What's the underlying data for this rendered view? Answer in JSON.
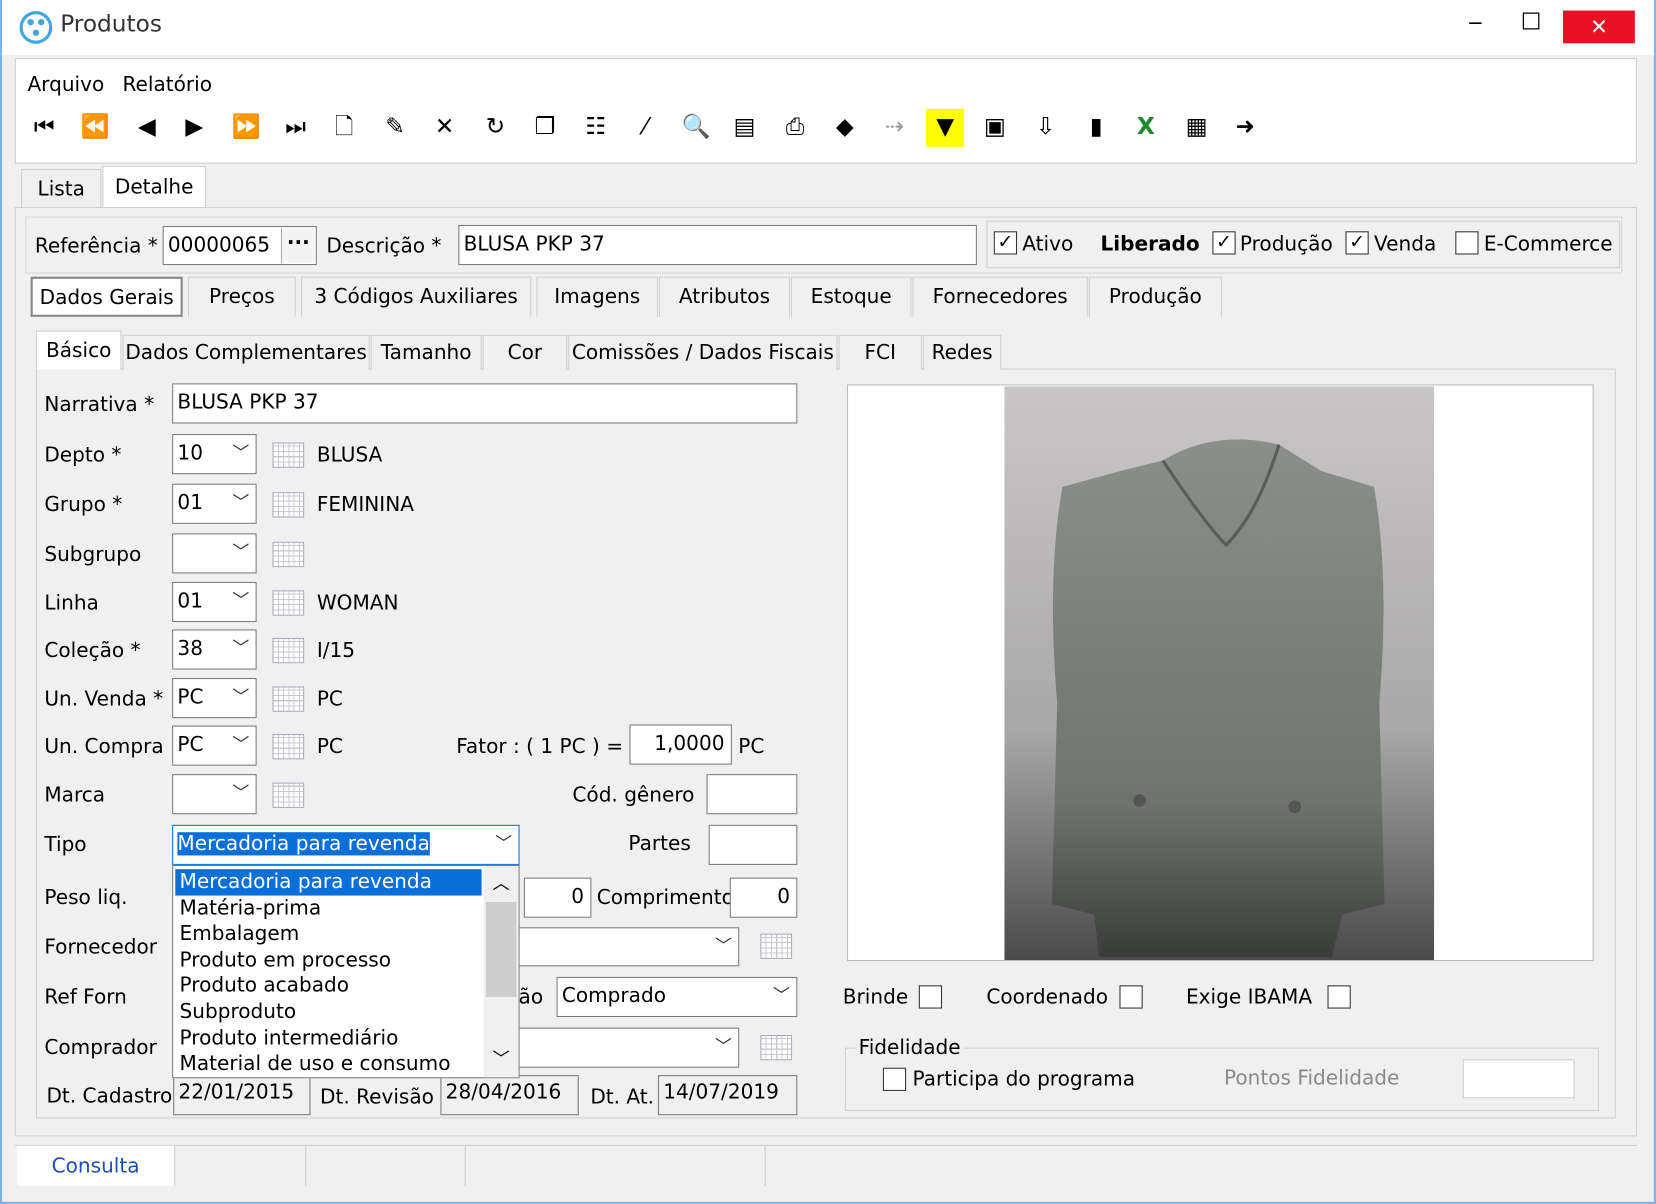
{
  "window": {
    "title": "Produtos",
    "minimize": "‒",
    "maximize": "☐",
    "close": "✕"
  },
  "menu": [
    "Arquivo",
    "Relatório"
  ],
  "toolbar": [
    {
      "name": "first-record-icon",
      "glyph": "⏮"
    },
    {
      "name": "previous-page-icon",
      "glyph": "⏪"
    },
    {
      "name": "previous-record-icon",
      "glyph": "◀"
    },
    {
      "name": "next-record-icon",
      "glyph": "▶"
    },
    {
      "name": "next-page-icon",
      "glyph": "⏩"
    },
    {
      "name": "last-record-icon",
      "glyph": "⏭"
    },
    {
      "name": "new-document-icon",
      "glyph": "🗋"
    },
    {
      "name": "edit-document-icon",
      "glyph": "✎"
    },
    {
      "name": "delete-icon",
      "glyph": "✕"
    },
    {
      "name": "refresh-icon",
      "glyph": "↻"
    },
    {
      "name": "copy-icon",
      "glyph": "❐"
    },
    {
      "name": "properties-icon",
      "glyph": "☷"
    },
    {
      "name": "magic-wand-icon",
      "glyph": "⁄"
    },
    {
      "name": "preview-icon",
      "glyph": "🔍"
    },
    {
      "name": "report-icon",
      "glyph": "▤"
    },
    {
      "name": "print-icon",
      "glyph": "⎙"
    },
    {
      "name": "tag-icon",
      "glyph": "◆"
    },
    {
      "name": "goto-icon",
      "glyph": "⇢"
    },
    {
      "name": "filter-icon",
      "glyph": "▼"
    },
    {
      "name": "monitor-icon",
      "glyph": "▣"
    },
    {
      "name": "export-icon",
      "glyph": "⇩"
    },
    {
      "name": "barcode-icon",
      "glyph": "▮"
    },
    {
      "name": "excel-icon",
      "glyph": "X"
    },
    {
      "name": "calculator-icon",
      "glyph": "▦"
    },
    {
      "name": "exit-icon",
      "glyph": "➜"
    }
  ],
  "tabs_main": [
    {
      "label": "Lista"
    },
    {
      "label": "Detalhe"
    }
  ],
  "header": {
    "ref_label": "Referência *",
    "ref_value": "00000065",
    "ref_btn": "···",
    "desc_label": "Descrição *",
    "desc_value": "BLUSA PKP 37",
    "ativo": "Ativo",
    "ativo_checked": true,
    "liberado": "Liberado",
    "producao": "Produção",
    "producao_checked": true,
    "venda": "Venda",
    "venda_checked": true,
    "ecommerce": "E-Commerce",
    "ecommerce_checked": false
  },
  "tabs_section": [
    "Dados Gerais",
    "Preços",
    "3 Códigos Auxiliares",
    "Imagens",
    "Atributos",
    "Estoque",
    "Fornecedores",
    "Produção"
  ],
  "tabs_sub": [
    "Básico",
    "Dados Complementares",
    "Tamanho",
    "Cor",
    "Comissões / Dados Fiscais",
    "FCI",
    "Redes"
  ],
  "form": {
    "narrativa": {
      "label": "Narrativa *",
      "value": "BLUSA PKP 37"
    },
    "depto": {
      "label": "Depto *",
      "value": "10",
      "desc": "BLUSA"
    },
    "grupo": {
      "label": "Grupo *",
      "value": "01",
      "desc": "FEMININA"
    },
    "subgrupo": {
      "label": "Subgrupo",
      "value": "",
      "desc": ""
    },
    "linha": {
      "label": "Linha",
      "value": "01",
      "desc": "WOMAN"
    },
    "colecao": {
      "label": "Coleção *",
      "value": "38",
      "desc": "I/15"
    },
    "un_venda": {
      "label": "Un. Venda *",
      "value": "PC",
      "desc": "PC"
    },
    "un_compra": {
      "label": "Un. Compra",
      "value": "PC",
      "desc": "PC"
    },
    "fator": {
      "label": "Fator : ( 1 PC ) =",
      "value": "1,0000",
      "unit": "PC"
    },
    "marca": {
      "label": "Marca",
      "value": ""
    },
    "cod_genero": {
      "label": "Cód. gênero",
      "value": ""
    },
    "tipo": {
      "label": "Tipo",
      "value": "Mercadoria para revenda"
    },
    "partes": {
      "label": "Partes",
      "value": ""
    },
    "peso": {
      "label": "Peso liq.",
      "value": "0"
    },
    "comprimento": {
      "label": "Comprimento",
      "value": "0"
    },
    "fornecedor": {
      "label": "Fornecedor",
      "value": ""
    },
    "ref_forn": {
      "label": "Ref Forn",
      "hidden_label_tail": "ão",
      "value": "Comprado"
    },
    "comprador": {
      "label": "Comprador",
      "value": ""
    },
    "dt_cadastro": {
      "label": "Dt. Cadastro",
      "value": "22/01/2015"
    },
    "dt_revisao": {
      "label": "Dt. Revisão",
      "value": "28/04/2016"
    },
    "dt_at": {
      "label": "Dt. At.",
      "value": "14/07/2019"
    }
  },
  "tipo_options": [
    "Mercadoria para revenda",
    "Matéria-prima",
    "Embalagem",
    "Produto em processo",
    "Produto acabado",
    "Subproduto",
    "Produto intermediário",
    "Material de uso e consumo"
  ],
  "options": {
    "brinde": "Brinde",
    "coordenado": "Coordenado",
    "ibama": "Exige IBAMA"
  },
  "fidelidade": {
    "title": "Fidelidade",
    "participa": "Participa do programa",
    "pontos": "Pontos Fidelidade",
    "pontos_value": ""
  },
  "status": {
    "mode": "Consulta"
  },
  "colors": {
    "accent": "#0a6fd8",
    "close": "#e81123",
    "status_text": "#1a4fb4"
  }
}
